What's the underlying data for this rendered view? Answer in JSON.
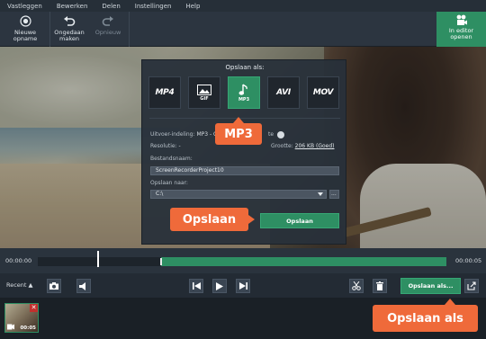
{
  "menu": [
    "Vastleggen",
    "Bewerken",
    "Delen",
    "Instellingen",
    "Help"
  ],
  "toolbar": {
    "new_recording": "Nieuwe opname",
    "undo": "Ongedaan maken",
    "redo": "Opnieuw",
    "open_editor": "In editor openen"
  },
  "dialog": {
    "title": "Opslaan als:",
    "formats": [
      {
        "label": "MP4",
        "icon": "film-icon"
      },
      {
        "label": "GIF",
        "icon": "image-icon"
      },
      {
        "label": "MP3",
        "icon": "music-note-icon",
        "active": true
      },
      {
        "label": "AVI",
        "icon": "film-icon"
      },
      {
        "label": "MOV",
        "icon": "film-icon"
      }
    ],
    "output_format_label": "Uitvoer-indeling:",
    "output_format_value": "MP3 - O",
    "output_format_tail": "te",
    "resolution_label": "Resolutie:",
    "resolution_value": "-",
    "size_label": "Grootte:",
    "size_value": "206 KB (Goed)",
    "filename_label": "Bestandsnaam:",
    "filename_value": "ScreenRecorderProject10",
    "save_to_label": "Opslaan naar:",
    "save_to_value": "C:\\",
    "browse": "...",
    "save_button": "Opslaan"
  },
  "callouts": {
    "mp3": "MP3",
    "opslaan": "Opslaan",
    "opslaan_als": "Opslaan als"
  },
  "timeline": {
    "start": "00:00:00",
    "end": "00:00:05",
    "progress": 0.79
  },
  "controls": {
    "recent_label": "Recent",
    "save_as_button": "Opslaan als..."
  },
  "recent": {
    "thumb_time": "00:05"
  },
  "colors": {
    "accent": "#2e8f63",
    "callout": "#ef6a3a"
  }
}
